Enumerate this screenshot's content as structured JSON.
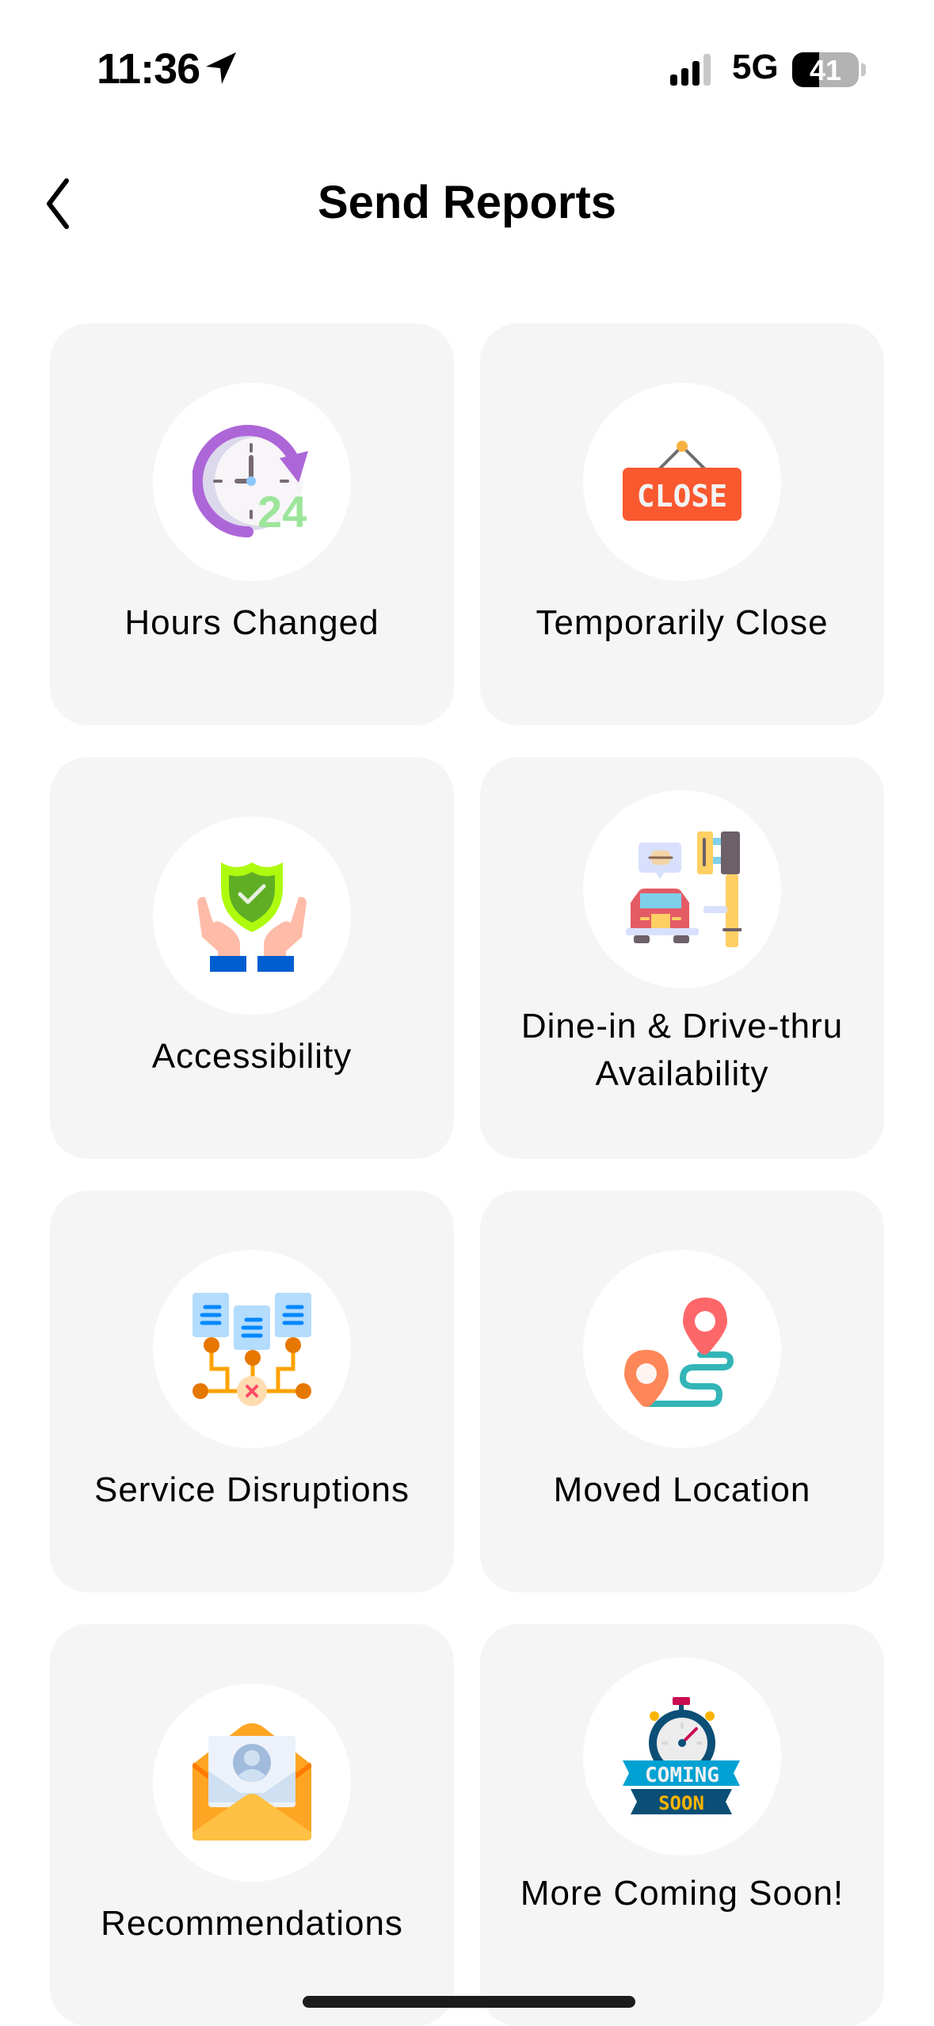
{
  "status_bar": {
    "time": "11:36",
    "network": "5G",
    "battery_percent": "41",
    "battery_level": 0.41,
    "signal_bars_active": 3,
    "signal_bars_total": 4,
    "location_icon": "location-arrow-icon"
  },
  "header": {
    "back_icon": "chevron-left-icon",
    "title": "Send Reports"
  },
  "report_options": [
    {
      "label": "Hours Changed",
      "icon": "clock-24-icon"
    },
    {
      "label": "Temporarily Close",
      "icon": "close-sign-icon",
      "sign_text": "CLOSE"
    },
    {
      "label": "Accessibility",
      "icon": "shield-hands-icon"
    },
    {
      "label": "Dine-in & Drive-thru Availability",
      "icon": "drive-thru-icon"
    },
    {
      "label": "Service Disruptions",
      "icon": "network-disruption-icon"
    },
    {
      "label": "Moved Location",
      "icon": "location-route-icon"
    },
    {
      "label": "Recommendations",
      "icon": "envelope-contact-icon"
    },
    {
      "label": "More Coming Soon!",
      "icon": "coming-soon-stopwatch-icon",
      "badge_top": "COMING",
      "badge_bottom": "SOON"
    }
  ],
  "colors": {
    "card_bg": "#f5f5f5",
    "icon_circle_bg": "#ffffff",
    "text": "#000000",
    "close_sign": "#fa582f",
    "clock_arrow": "#ad66d8",
    "clock_24": "#9de59b",
    "shield": "#aefa0e",
    "pin_red": "#fe676a",
    "pin_orange": "#fd8759",
    "route": "#33b5b7",
    "envelope": "#fea524",
    "coming_blue": "#00a2d3",
    "soon_navy": "#0b4e76",
    "soon_yellow": "#fbb400"
  }
}
